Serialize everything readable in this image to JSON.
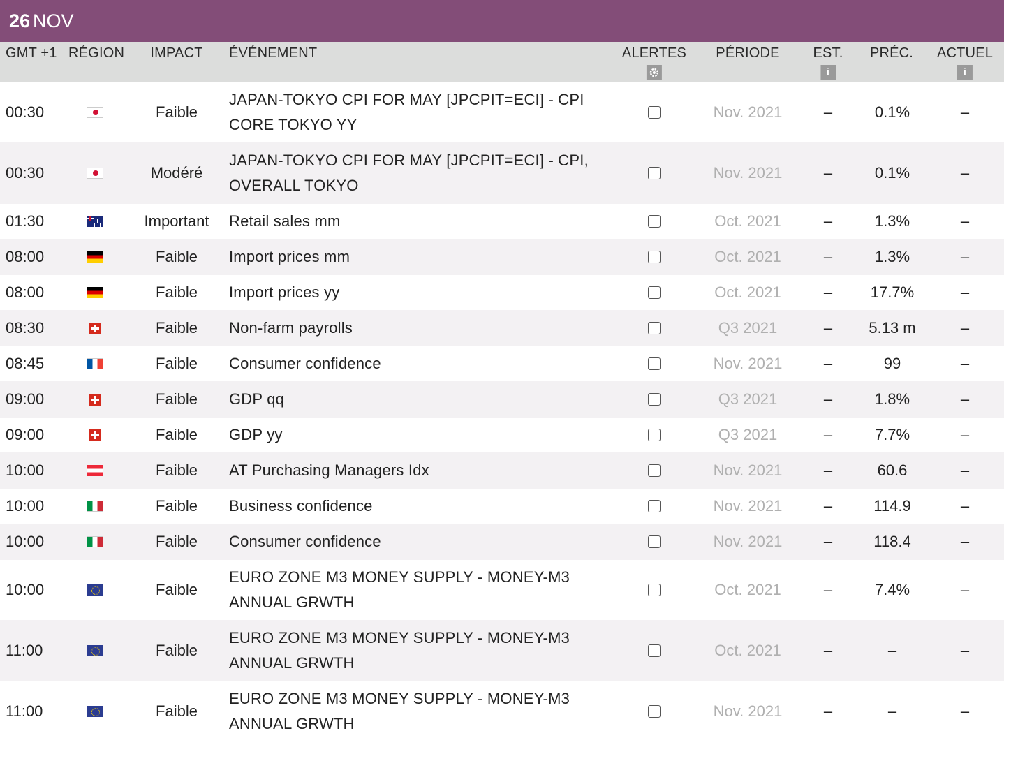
{
  "date": {
    "day": "26",
    "month": "NOV"
  },
  "columns": {
    "time": "GMT +1",
    "region": "RÉGION",
    "impact": "IMPACT",
    "event": "ÉVÉNEMENT",
    "alerts": "ALERTES",
    "period": "PÉRIODE",
    "est": "EST.",
    "prev": "PRÉC.",
    "actual": "ACTUEL",
    "info_glyph": "i"
  },
  "colors": {
    "date_bar": "#834d78",
    "header_bg": "#dcdddc",
    "alt_row": "#f3f1f3",
    "period_text": "#b0b0b0"
  },
  "rows": [
    {
      "time": "00:30",
      "flag": "jp",
      "impact": "Faible",
      "event": "JAPAN-TOKYO CPI FOR MAY [JPCPIT=ECI] - CPI CORE TOKYO YY",
      "period": "Nov. 2021",
      "est": "–",
      "prev": "0.1%",
      "actual": "–"
    },
    {
      "time": "00:30",
      "flag": "jp",
      "impact": "Modéré",
      "event": "JAPAN-TOKYO CPI FOR MAY [JPCPIT=ECI] - CPI, OVERALL TOKYO",
      "period": "Nov. 2021",
      "est": "–",
      "prev": "0.1%",
      "actual": "–"
    },
    {
      "time": "01:30",
      "flag": "au",
      "impact": "Important",
      "event": "Retail sales mm",
      "period": "Oct. 2021",
      "est": "–",
      "prev": "1.3%",
      "actual": "–"
    },
    {
      "time": "08:00",
      "flag": "de",
      "impact": "Faible",
      "event": "Import prices mm",
      "period": "Oct. 2021",
      "est": "–",
      "prev": "1.3%",
      "actual": "–"
    },
    {
      "time": "08:00",
      "flag": "de",
      "impact": "Faible",
      "event": "Import prices yy",
      "period": "Oct. 2021",
      "est": "–",
      "prev": "17.7%",
      "actual": "–"
    },
    {
      "time": "08:30",
      "flag": "ch",
      "impact": "Faible",
      "event": "Non-farm payrolls",
      "period": "Q3 2021",
      "est": "–",
      "prev": "5.13 m",
      "actual": "–"
    },
    {
      "time": "08:45",
      "flag": "fr",
      "impact": "Faible",
      "event": "Consumer confidence",
      "period": "Nov. 2021",
      "est": "–",
      "prev": "99",
      "actual": "–"
    },
    {
      "time": "09:00",
      "flag": "ch",
      "impact": "Faible",
      "event": "GDP qq",
      "period": "Q3 2021",
      "est": "–",
      "prev": "1.8%",
      "actual": "–"
    },
    {
      "time": "09:00",
      "flag": "ch",
      "impact": "Faible",
      "event": "GDP yy",
      "period": "Q3 2021",
      "est": "–",
      "prev": "7.7%",
      "actual": "–"
    },
    {
      "time": "10:00",
      "flag": "at",
      "impact": "Faible",
      "event": "AT Purchasing Managers Idx",
      "period": "Nov. 2021",
      "est": "–",
      "prev": "60.6",
      "actual": "–"
    },
    {
      "time": "10:00",
      "flag": "it",
      "impact": "Faible",
      "event": "Business confidence",
      "period": "Nov. 2021",
      "est": "–",
      "prev": "114.9",
      "actual": "–"
    },
    {
      "time": "10:00",
      "flag": "it",
      "impact": "Faible",
      "event": "Consumer confidence",
      "period": "Nov. 2021",
      "est": "–",
      "prev": "118.4",
      "actual": "–"
    },
    {
      "time": "10:00",
      "flag": "eu",
      "impact": "Faible",
      "event": "EURO ZONE M3 MONEY SUPPLY - MONEY-M3 ANNUAL GRWTH",
      "period": "Oct. 2021",
      "est": "–",
      "prev": "7.4%",
      "actual": "–"
    },
    {
      "time": "11:00",
      "flag": "eu",
      "impact": "Faible",
      "event": "EURO ZONE M3 MONEY SUPPLY - MONEY-M3 ANNUAL GRWTH",
      "period": "Oct. 2021",
      "est": "–",
      "prev": "–",
      "actual": "–"
    },
    {
      "time": "11:00",
      "flag": "eu",
      "impact": "Faible",
      "event": "EURO ZONE M3 MONEY SUPPLY - MONEY-M3 ANNUAL GRWTH",
      "period": "Nov. 2021",
      "est": "–",
      "prev": "–",
      "actual": "–"
    }
  ]
}
